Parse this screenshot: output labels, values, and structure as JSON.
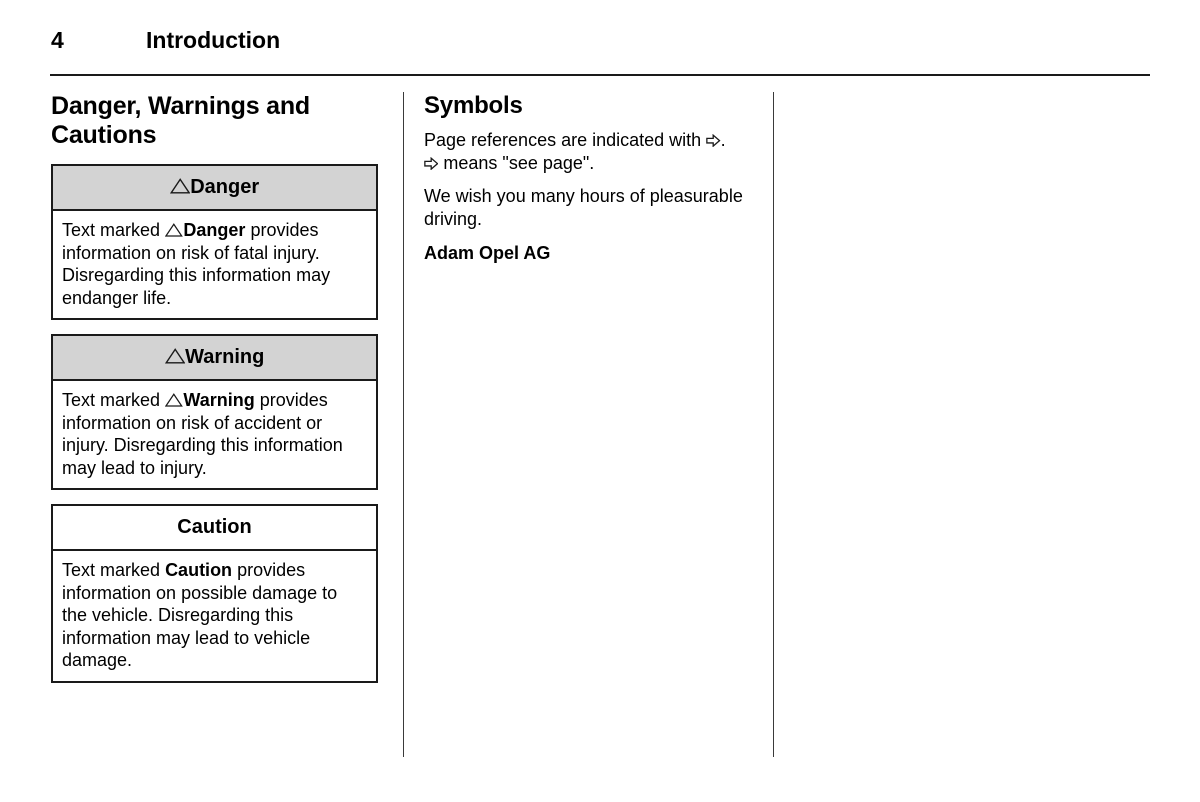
{
  "header": {
    "page_number": "4",
    "title": "Introduction"
  },
  "left_column": {
    "heading": "Danger, Warnings and Cautions",
    "notices": [
      {
        "id": "danger",
        "header_label": "Danger",
        "header_shaded": true,
        "header_has_triangle": true,
        "body_prefix": "Text marked",
        "body_keyword": "Danger",
        "body_suffix": "provides information on risk of fatal injury. Disregarding this information may endanger life.",
        "body_has_triangle": true
      },
      {
        "id": "warning",
        "header_label": "Warning",
        "header_shaded": true,
        "header_has_triangle": true,
        "body_prefix": "Text marked",
        "body_keyword": "Warning",
        "body_suffix": "provides information on risk of accident or injury. Disregarding this information may lead to injury.",
        "body_has_triangle": true
      },
      {
        "id": "caution",
        "header_label": "Caution",
        "header_shaded": false,
        "header_has_triangle": false,
        "body_prefix": "Text marked",
        "body_keyword": "Caution",
        "body_suffix": "provides information on possible damage to the vehicle. Disregarding this information may lead to vehicle damage.",
        "body_has_triangle": false
      }
    ]
  },
  "middle_column": {
    "heading": "Symbols",
    "paragraph_1_part_1": "Page references are indicated with",
    "paragraph_1_part_2": ".",
    "paragraph_1_part_3": "means \"see page\".",
    "paragraph_2": "We wish you many hours of pleasurable driving.",
    "signature": "Adam Opel AG"
  },
  "colors": {
    "ink": "#1a1a1a",
    "notice_header_shade": "#d3d3d3",
    "rule": "#3a3a3a",
    "page_background": "#ffffff"
  },
  "icons": {
    "warning_triangle": "warning-triangle-icon",
    "page_reference_arrow": "page-reference-arrow-icon"
  }
}
